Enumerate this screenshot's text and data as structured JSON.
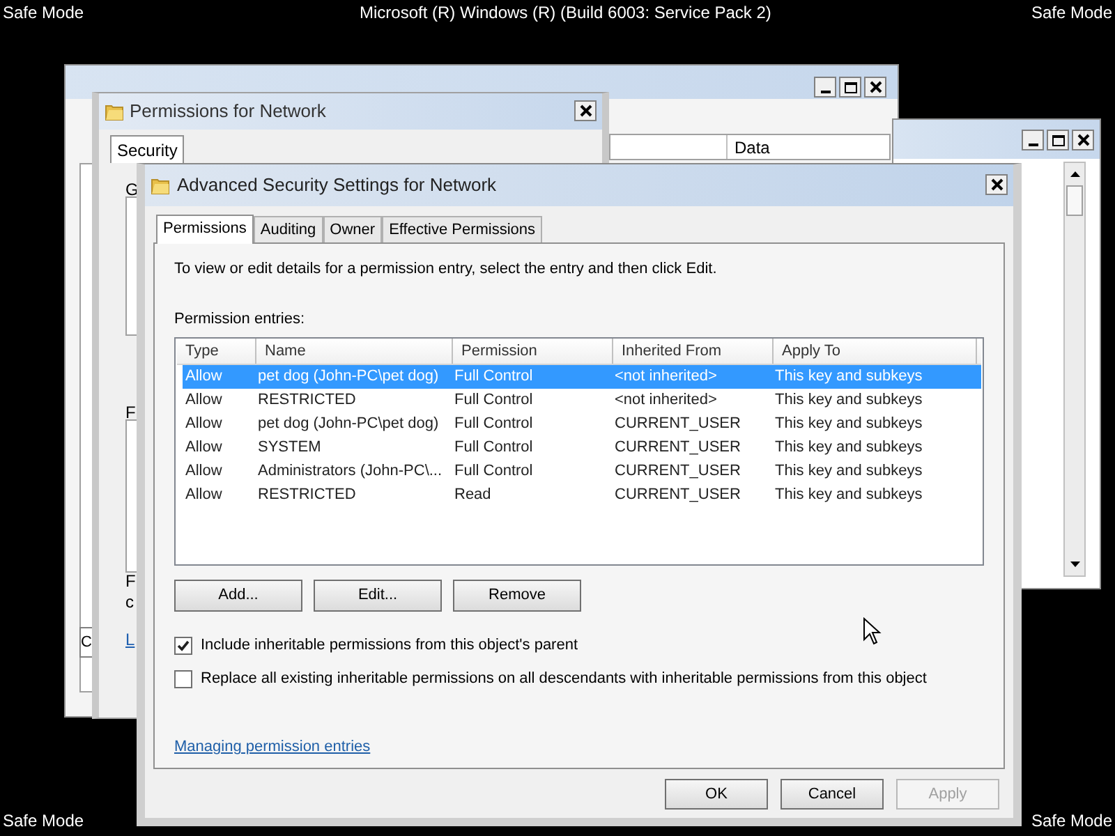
{
  "screen": {
    "top_left": "Safe Mode",
    "top_center": "Microsoft (R) Windows (R) (Build 6003: Service Pack 2)",
    "top_right": "Safe Mode",
    "bottom_left": "Safe Mode",
    "bottom_right": "Safe Mode"
  },
  "registry_window": {
    "column_header": "Data",
    "fragment": "C"
  },
  "permissions_window": {
    "title": "Permissions for Network",
    "tabs": [
      {
        "label": "Security",
        "selected": true
      }
    ],
    "fragments": [
      "G",
      "F",
      "F",
      "c",
      "L"
    ]
  },
  "dialog": {
    "title": "Advanced Security Settings for Network",
    "tabs": [
      {
        "label": "Permissions",
        "selected": true
      },
      {
        "label": "Auditing",
        "selected": false
      },
      {
        "label": "Owner",
        "selected": false
      },
      {
        "label": "Effective Permissions",
        "selected": false
      }
    ],
    "instructions": "To view or edit details for a permission entry, select the entry and then click Edit.",
    "entries_label": "Permission entries:",
    "columns": [
      "Type",
      "Name",
      "Permission",
      "Inherited From",
      "Apply To"
    ],
    "rows": [
      {
        "cells": [
          "Allow",
          "pet dog (John-PC\\pet dog)",
          "Full Control",
          "<not inherited>",
          "This key and subkeys"
        ],
        "selected": true
      },
      {
        "cells": [
          "Allow",
          "RESTRICTED",
          "Full Control",
          "<not inherited>",
          "This key and subkeys"
        ],
        "selected": false
      },
      {
        "cells": [
          "Allow",
          "pet dog (John-PC\\pet dog)",
          "Full Control",
          "CURRENT_USER",
          "This key and subkeys"
        ],
        "selected": false
      },
      {
        "cells": [
          "Allow",
          "SYSTEM",
          "Full Control",
          "CURRENT_USER",
          "This key and subkeys"
        ],
        "selected": false
      },
      {
        "cells": [
          "Allow",
          "Administrators (John-PC\\...",
          "Full Control",
          "CURRENT_USER",
          "This key and subkeys"
        ],
        "selected": false
      },
      {
        "cells": [
          "Allow",
          "RESTRICTED",
          "Read",
          "CURRENT_USER",
          "This key and subkeys"
        ],
        "selected": false
      }
    ],
    "entry_buttons": [
      "Add...",
      "Edit...",
      "Remove"
    ],
    "options": [
      {
        "label": "Include inheritable permissions from this object's parent",
        "checked": true
      },
      {
        "label": "Replace all existing inheritable permissions on all descendants with inheritable permissions from this object",
        "checked": false
      }
    ],
    "link": "Managing permission entries",
    "footer_buttons": [
      {
        "label": "OK",
        "disabled": false
      },
      {
        "label": "Cancel",
        "disabled": false
      },
      {
        "label": "Apply",
        "disabled": true
      }
    ]
  }
}
